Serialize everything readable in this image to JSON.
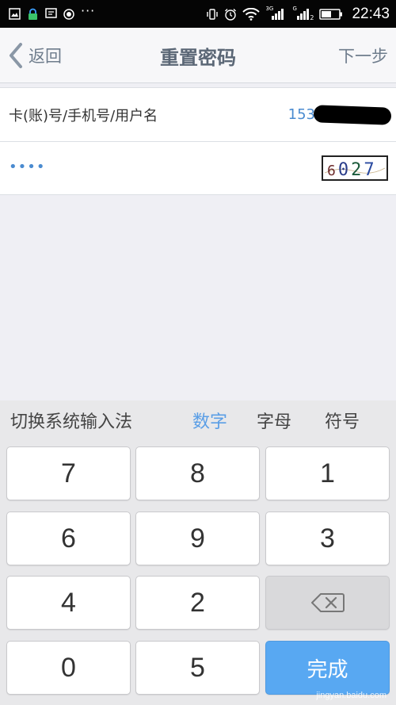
{
  "status_bar": {
    "time": "22:43",
    "network_label_1": "3G",
    "network_label_2": "G",
    "sim_2": "2",
    "dots": "···"
  },
  "nav": {
    "back_label": "返回",
    "title": "重置密码",
    "next_label": "下一步"
  },
  "form": {
    "account_label": "卡(账)号/手机号/用户名",
    "account_value": "153",
    "password_mask": "••••",
    "captcha_text": "6027"
  },
  "keyboard": {
    "switch_label": "切换系统输入法",
    "modes": [
      "数字",
      "字母",
      "符号"
    ],
    "active_mode": "数字",
    "keys": [
      "7",
      "8",
      "1",
      "6",
      "9",
      "3",
      "4",
      "2",
      "0",
      "5"
    ],
    "done_label": "完成"
  },
  "watermark": {
    "site": "jingyan.baidu.com"
  },
  "colors": {
    "accent": "#5a9ee6",
    "done_key": "#58a8f2",
    "nav_text": "#5b6776",
    "value_text": "#4a8bd0"
  }
}
